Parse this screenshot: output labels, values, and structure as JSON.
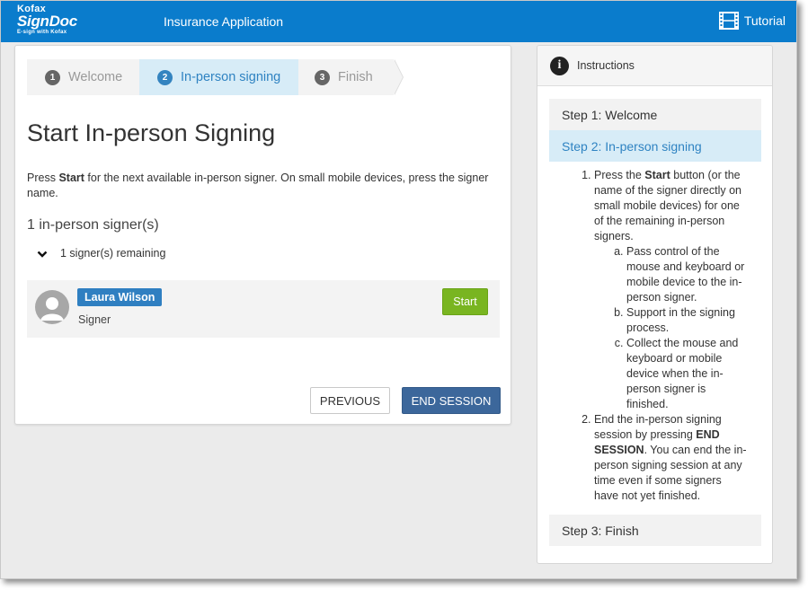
{
  "topbar": {
    "logo_line1": "Kofax",
    "logo_line2": "SignDoc",
    "logo_tagline": "E-sign with Kofax",
    "app_title": "Insurance Application",
    "tutorial_label": "Tutorial",
    "tutorial_icon": "film-icon"
  },
  "wizard": {
    "steps": [
      {
        "num": "1",
        "label": "Welcome"
      },
      {
        "num": "2",
        "label": "In-person signing"
      },
      {
        "num": "3",
        "label": "Finish"
      }
    ],
    "active": 2
  },
  "main": {
    "title": "Start In-person Signing",
    "intro_pre": "Press ",
    "intro_bold": "Start",
    "intro_post": " for the next available in-person signer. On small mobile devices, press the signer name.",
    "signer_count": "1 in-person signer(s)",
    "remaining_label": "1 signer(s) remaining",
    "signer": {
      "name": "Laura Wilson",
      "role": "Signer",
      "start_label": "Start"
    },
    "previous_label": "PREVIOUS",
    "end_session_label": "END SESSION"
  },
  "instructions": {
    "header": "Instructions",
    "step1": "Step 1: Welcome",
    "step2": "Step 2: In-person signing",
    "step3": "Step 3: Finish",
    "item1_pre": "Press the ",
    "item1_bold": "Start",
    "item1_post": " button (or the name of the signer directly on small mobile devices) for one of the remaining in-person signers.",
    "sub_a": "Pass control of the mouse and keyboard or mobile device to the in-person signer.",
    "sub_b": "Support in the signing process.",
    "sub_c": "Collect the mouse and keyboard or mobile device when the in-person signer is finished.",
    "item2_pre": "End the in-person signing session by pressing ",
    "item2_bold": "END SESSION",
    "item2_post": ". You can end the in-person signing session at any time even if some signers have not yet finished."
  },
  "colors": {
    "topbar": "#0a7ccc",
    "active_step_bg": "#d7ecf7",
    "active_step_text": "#2f83c2",
    "start_button": "#79b521",
    "end_session_button": "#3c679b",
    "signer_badge": "#2f7fc1"
  }
}
